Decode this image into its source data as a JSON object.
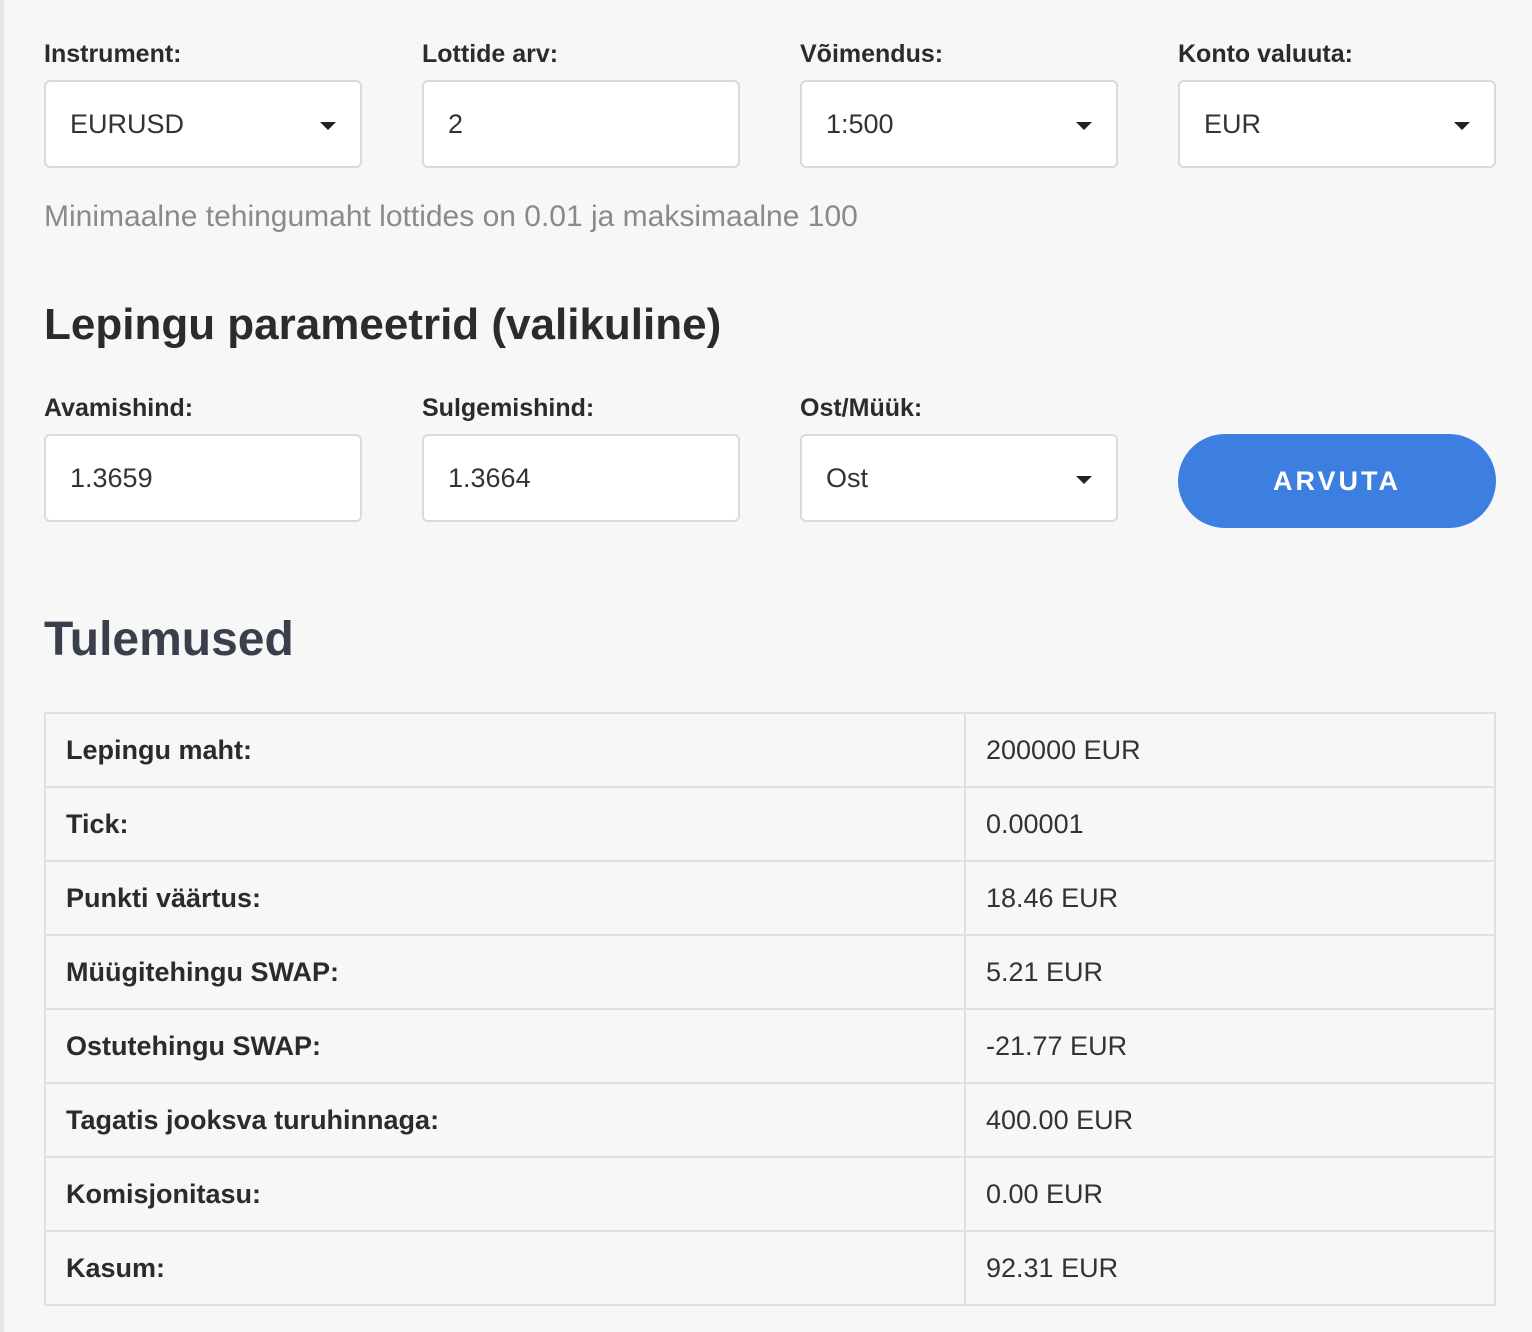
{
  "top_fields": [
    {
      "label": "Instrument:",
      "value": "EURUSD",
      "type": "select"
    },
    {
      "label": "Lottide arv:",
      "value": "2",
      "type": "input"
    },
    {
      "label": "Võimendus:",
      "value": "1:500",
      "type": "select"
    },
    {
      "label": "Konto valuuta:",
      "value": "EUR",
      "type": "select"
    }
  ],
  "hint": "Minimaalne tehingumaht lottides on 0.01 ja maksimaalne 100",
  "contract_section": {
    "title": "Lepingu parameetrid (valikuline)",
    "fields": [
      {
        "label": "Avamishind:",
        "value": "1.3659",
        "type": "input"
      },
      {
        "label": "Sulgemishind:",
        "value": "1.3664",
        "type": "input"
      },
      {
        "label": "Ost/Müük:",
        "value": "Ost",
        "type": "select"
      }
    ],
    "button_label": "ARVUTA"
  },
  "results": {
    "title": "Tulemused",
    "rows": [
      {
        "label": "Lepingu maht:",
        "value": "200000 EUR"
      },
      {
        "label": "Tick:",
        "value": "0.00001"
      },
      {
        "label": "Punkti väärtus:",
        "value": "18.46 EUR"
      },
      {
        "label": "Müügitehingu SWAP:",
        "value": "5.21 EUR"
      },
      {
        "label": "Ostutehingu SWAP:",
        "value": "-21.77 EUR"
      },
      {
        "label": "Tagatis jooksva turuhinnaga:",
        "value": "400.00 EUR"
      },
      {
        "label": "Komisjonitasu:",
        "value": "0.00 EUR"
      },
      {
        "label": "Kasum:",
        "value": "92.31 EUR"
      }
    ]
  },
  "colors": {
    "accent": "#3d7fe0",
    "background": "#f7f7f7"
  },
  "icons": {
    "select_caret": "caret-down-icon"
  }
}
